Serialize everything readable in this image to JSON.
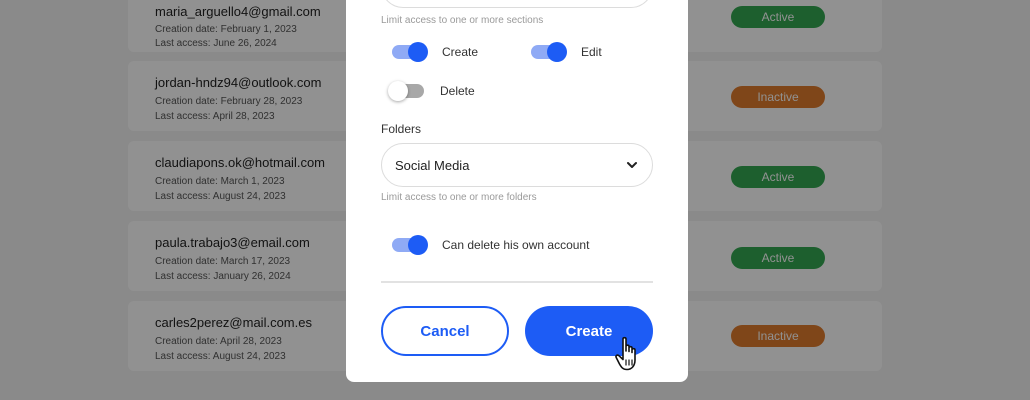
{
  "users": [
    {
      "email": "maria_arguello4@gmail.com",
      "created": "Creation date: February 1, 2023",
      "last_access": "Last access: June 26, 2024",
      "status": "Active"
    },
    {
      "email": "jordan-hndz94@outlook.com",
      "created": "Creation date: February 28, 2023",
      "last_access": "Last access: April 28, 2023",
      "status": "Inactive"
    },
    {
      "email": "claudiapons.ok@hotmail.com",
      "created": "Creation date: March 1, 2023",
      "last_access": "Last access: August 24, 2023",
      "status": "Active"
    },
    {
      "email": "paula.trabajo3@email.com",
      "created": "Creation date: March 17, 2023",
      "last_access": "Last access: January 26, 2024",
      "status": "Active"
    },
    {
      "email": "carles2perez@mail.com.es",
      "created": "Creation date: April 28, 2023",
      "last_access": "Last access: August 24, 2023",
      "status": "Inactive"
    }
  ],
  "status_colors": {
    "active": "#33a852",
    "inactive": "#e07c2c"
  },
  "modal": {
    "sections_hint": "Limit access to one or more sections",
    "permissions": [
      {
        "label": "Create",
        "enabled": true
      },
      {
        "label": "Edit",
        "enabled": true
      },
      {
        "label": "Delete",
        "enabled": false
      }
    ],
    "folders_label": "Folders",
    "folders_value": "Social Media",
    "folders_hint": "Limit access to one or more folders",
    "delete_own_account": {
      "label": "Can delete his own account",
      "enabled": true
    },
    "cancel_label": "Cancel",
    "create_label": "Create"
  },
  "accent": "#1d5cf5"
}
